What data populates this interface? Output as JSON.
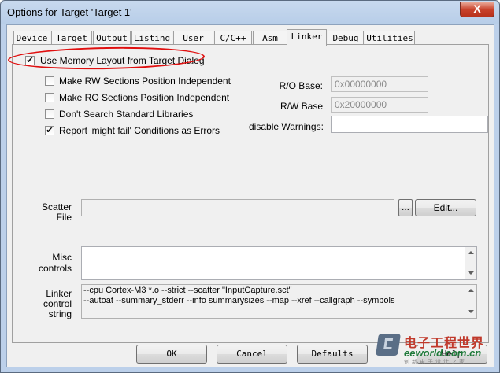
{
  "window": {
    "title": "Options for Target 'Target 1'",
    "close_glyph": "X"
  },
  "tabs": [
    {
      "label": "Device",
      "active": false
    },
    {
      "label": "Target",
      "active": false
    },
    {
      "label": "Output",
      "active": false
    },
    {
      "label": "Listing",
      "active": false
    },
    {
      "label": "User",
      "active": false
    },
    {
      "label": "C/C++",
      "active": false
    },
    {
      "label": "Asm",
      "active": false
    },
    {
      "label": "Linker",
      "active": true
    },
    {
      "label": "Debug",
      "active": false
    },
    {
      "label": "Utilities",
      "active": false
    }
  ],
  "options": {
    "use_memory_layout": {
      "label": "Use Memory Layout from Target Dialog",
      "checked": true
    },
    "rw_position_independent": {
      "label": "Make RW Sections Position Independent",
      "checked": false
    },
    "ro_position_independent": {
      "label": "Make RO Sections Position Independent",
      "checked": false
    },
    "dont_search_std_libs": {
      "label": "Don't Search Standard Libraries",
      "checked": false
    },
    "might_fail_as_errors": {
      "label": "Report 'might fail' Conditions as Errors",
      "checked": true
    }
  },
  "check_glyph": "✔",
  "memory": {
    "ro_base_label": "R/O Base:",
    "ro_base_value": "0x00000000",
    "rw_base_label": "R/W Base",
    "rw_base_value": "0x20000000",
    "disable_warnings_label": "disable Warnings:",
    "disable_warnings_value": ""
  },
  "scatter": {
    "label_line1": "Scatter",
    "label_line2": "File",
    "value": "",
    "browse_label": "...",
    "edit_label": "Edit..."
  },
  "misc": {
    "label_line1": "Misc",
    "label_line2": "controls",
    "value": ""
  },
  "linker_control": {
    "label_line1": "Linker",
    "label_line2": "control",
    "label_line3": "string",
    "line1": "--cpu Cortex-M3 *.o --strict --scatter \"InputCapture.sct\"",
    "line2": "--autoat --summary_stderr --info summarysizes --map --xref --callgraph --symbols"
  },
  "buttons": {
    "ok": "OK",
    "cancel": "Cancel",
    "defaults": "Defaults",
    "help": "Help"
  },
  "watermark": {
    "cn": "电子工程世界",
    "en": "eeworld.com.cn",
    "sub": "创新电子设计之家"
  }
}
